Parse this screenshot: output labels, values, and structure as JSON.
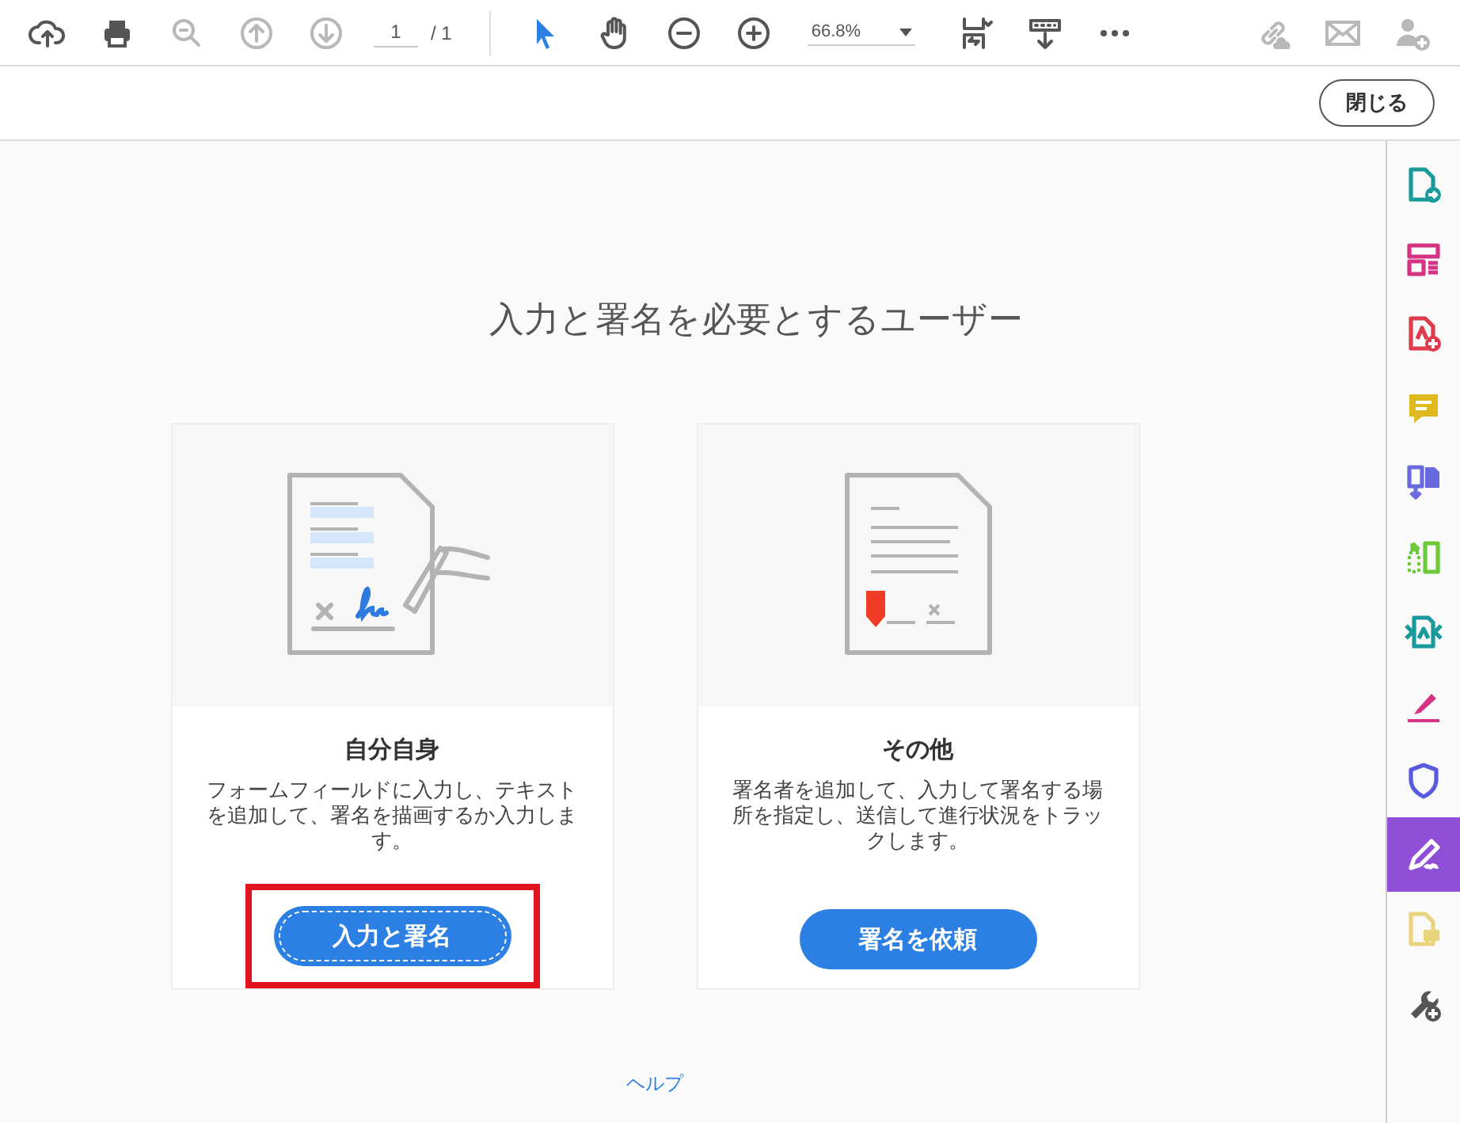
{
  "toolbar": {
    "file_tools": [
      {
        "kind": "upload",
        "disabled": false
      },
      {
        "kind": "print",
        "disabled": false
      },
      {
        "kind": "zoom-search",
        "disabled": true
      },
      {
        "kind": "page-up",
        "disabled": true
      },
      {
        "kind": "page-down",
        "disabled": true
      }
    ],
    "page": {
      "value": "1",
      "total": "/ 1"
    },
    "view_tools": [
      {
        "kind": "pointer",
        "selected": true
      },
      {
        "kind": "hand",
        "selected": false
      },
      {
        "kind": "zoom-out",
        "selected": false
      },
      {
        "kind": "zoom-in",
        "selected": false
      }
    ],
    "zoom": {
      "value": "66.8%"
    },
    "layout_tools": [
      {
        "kind": "fit-page"
      },
      {
        "kind": "scroll-mode"
      },
      {
        "kind": "more"
      }
    ],
    "share_tools": [
      {
        "kind": "link",
        "disabled": true
      },
      {
        "kind": "mail",
        "disabled": true
      },
      {
        "kind": "add-person",
        "disabled": true
      }
    ]
  },
  "close_button": "閉じる",
  "heading": "入力と署名を必要とするユーザー",
  "cards": [
    {
      "kind": "self",
      "title": "自分自身",
      "description": "フォームフィールドに入力し、テキストを追加して、署名を描画するか入力します。",
      "button": "入力と署名",
      "highlighted": true
    },
    {
      "kind": "others",
      "title": "その他",
      "description": "署名者を追加して、入力して署名する場所を指定し、送信して進行状況をトラックします。",
      "button": "署名を依頼",
      "highlighted": false
    }
  ],
  "help_link": "ヘルプ",
  "sidebar_tools": [
    {
      "kind": "export",
      "color": "#1a9a9a",
      "selected": false
    },
    {
      "kind": "organize",
      "color": "#d63384",
      "selected": false
    },
    {
      "kind": "create",
      "color": "#e03b4a",
      "selected": false
    },
    {
      "kind": "comment",
      "color": "#e0b820",
      "selected": false
    },
    {
      "kind": "combine",
      "color": "#6a6adf",
      "selected": false
    },
    {
      "kind": "compare",
      "color": "#6cc93a",
      "selected": false
    },
    {
      "kind": "compress",
      "color": "#1a9a9a",
      "selected": false
    },
    {
      "kind": "edit",
      "color": "#d63384",
      "selected": false
    },
    {
      "kind": "protect",
      "color": "#5a5ae0",
      "selected": false
    },
    {
      "kind": "sign",
      "color": "#8f4fd6",
      "selected": true
    },
    {
      "kind": "review",
      "color": "#e8d47a",
      "selected": false
    },
    {
      "kind": "more-tools",
      "color": "#555555",
      "selected": false
    }
  ]
}
